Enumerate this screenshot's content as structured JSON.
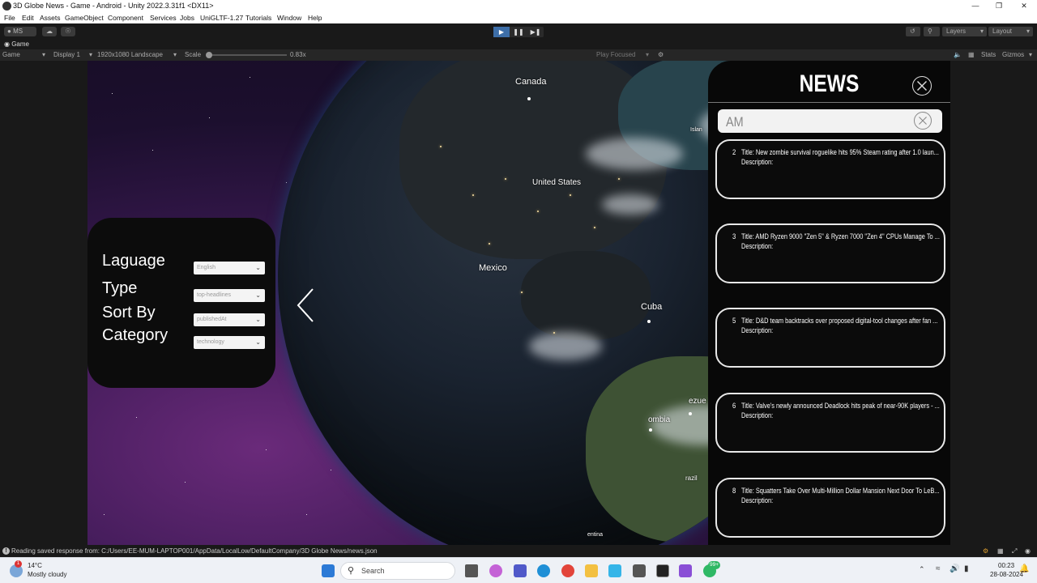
{
  "window": {
    "title": "3D Globe News - Game - Android - Unity 2022.3.31f1 <DX11>"
  },
  "menu": [
    "File",
    "Edit",
    "Assets",
    "GameObject",
    "Component",
    "Services",
    "Jobs",
    "UniGLTF-1.27",
    "Tutorials",
    "Window",
    "Help"
  ],
  "toolbar": {
    "account": "MS",
    "layers": "Layers",
    "layout": "Layout"
  },
  "game_tab": {
    "label": "Game"
  },
  "game_toolbar": {
    "mode": "Game",
    "display": "Display 1",
    "resolution": "1920x1080 Landscape",
    "scale_label": "Scale",
    "scale_value": "0.83x",
    "play_focused": "Play Focused",
    "stats": "Stats",
    "gizmos": "Gizmos"
  },
  "globe": {
    "labels": {
      "canada": "Canada",
      "united_states": "United States",
      "mexico": "Mexico",
      "cuba": "Cuba",
      "colombia": "ombia",
      "venezuela": "ezue",
      "brazil": "razil",
      "argentina": "entina",
      "islands": "Islan"
    }
  },
  "settings": {
    "language_label": "Laguage",
    "language_value": "English",
    "type_label": "Type",
    "type_value": "top-headlines",
    "sortby_label": "Sort By",
    "sortby_value": "publishedAt",
    "category_label": "Category",
    "category_value": "technology"
  },
  "news": {
    "heading": "NEWS",
    "search_value": "AM",
    "items": [
      {
        "num": "2",
        "title": "Title: New zombie survival roguelike hits 95% Steam rating after 1.0 laun...",
        "description": "Description:"
      },
      {
        "num": "3",
        "title": "Title: AMD Ryzen 9000 \"Zen 5\" & Ryzen 7000 \"Zen 4\" CPUs Manage To ...",
        "description": "Description:"
      },
      {
        "num": "5",
        "title": "Title: D&D team backtracks over proposed digital-tool changes after fan ...",
        "description": "Description:"
      },
      {
        "num": "6",
        "title": "Title: Valve's newly announced Deadlock hits peak of near-90K players - ...",
        "description": "Description:"
      },
      {
        "num": "8",
        "title": "Title: Squatters Take Over Multi-Million Dollar Mansion Next Door To LeB...",
        "description": "Description:"
      }
    ]
  },
  "status": {
    "message": "Reading saved response from: C:/Users/EE-MUM-LAPTOP001/AppData/LocalLow/DefaultCompany/3D Globe News/news.json"
  },
  "taskbar": {
    "weather_temp": "14°C",
    "weather_desc": "Mostly cloudy",
    "weather_badge": "1",
    "search_label": "Search",
    "whatsapp_badge": "99+",
    "time": "00:23",
    "date": "28-08-2024"
  }
}
